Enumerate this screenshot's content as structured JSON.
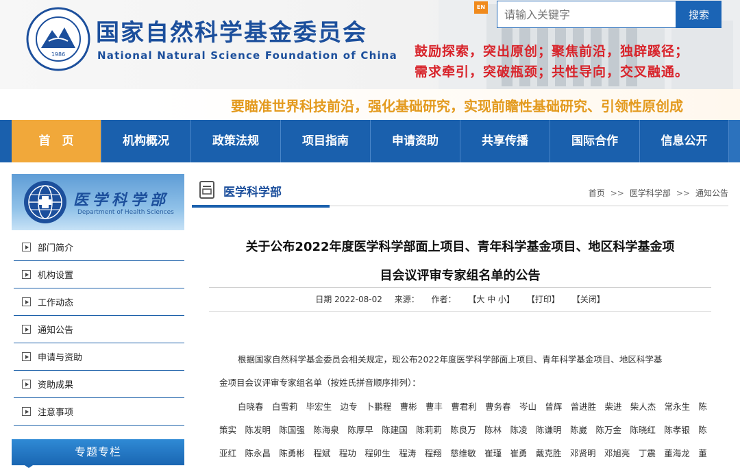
{
  "header": {
    "org_cn": "国家自然科学基金委员会",
    "org_en": "National Natural Science Foundation of China",
    "emblem_year": "1986",
    "lang_switch": "EN",
    "search": {
      "placeholder": "请输入关键字",
      "button": "搜索"
    },
    "slogan_line1": "鼓励探索，突出原创；聚焦前沿，独辟蹊径；",
    "slogan_line2": "需求牵引，突破瓶颈；共性导向，交叉融通。",
    "banner": "要瞄准世界科技前沿，强化基础研究，实现前瞻性基础研究、引领性原创成"
  },
  "nav": {
    "items": [
      "首　页",
      "机构概况",
      "政策法规",
      "项目指南",
      "申请资助",
      "共享传播",
      "国际合作",
      "信息公开"
    ],
    "active": "首　页"
  },
  "sidebar": {
    "dept_cn": "医学科学部",
    "dept_en": "Department of Health Sciences",
    "items": [
      "部门简介",
      "机构设置",
      "工作动态",
      "通知公告",
      "申请与资助",
      "资助成果",
      "注意事项"
    ],
    "special": "专题专栏"
  },
  "main": {
    "section_title": "医学科学部",
    "breadcrumb": [
      "首页",
      "医学科学部",
      "通知公告"
    ],
    "breadcrumb_sep": ">>",
    "title_line1": "关于公布2022年度医学科学部面上项目、青年科学基金项目、地区科学基金项",
    "title_line2": "目会议评审专家组名单的公告",
    "meta": {
      "date": "日期 2022-08-02",
      "source": "来源：",
      "author": "作者：",
      "font_size": "【大 中 小】",
      "print": "【打印】",
      "close": "【关闭】"
    },
    "para1_line1": "根据国家自然科学基金委员会相关规定，现公布2022年度医学科学部面上项目、青年科学基金项目、地区科学基",
    "para1_line2": "金项目会议评审专家组名单（按姓氏拼音顺序排列）：",
    "names": [
      [
        "白晓春",
        "白雪莉",
        "毕宏生",
        "边专",
        "卜鹏程",
        "曹彬",
        "曹丰",
        "曹君利",
        "曹务春",
        "岑山",
        "曾辉",
        "曾进胜",
        "柴进",
        "柴人杰",
        "常永生",
        "陈"
      ],
      [
        "策实",
        "陈发明",
        "陈国强",
        "陈海泉",
        "陈厚早",
        "陈建国",
        "陈莉莉",
        "陈良万",
        "陈林",
        "陈凌",
        "陈谦明",
        "陈崴",
        "陈万金",
        "陈晓红",
        "陈孝银",
        "陈"
      ],
      [
        "亚红",
        "陈永昌",
        "陈勇彬",
        "程斌",
        "程功",
        "程卯生",
        "程涛",
        "程翔",
        "慈维敏",
        "崔瑾",
        "崔勇",
        "戴克胜",
        "邓贤明",
        "邓旭亮",
        "丁震",
        "董海龙",
        "董"
      ]
    ]
  },
  "colors": {
    "brand_blue": "#1a60ad",
    "nav_active": "#f1a83a",
    "slogan_red": "#d8232a",
    "banner_orange": "#e39a1e"
  }
}
